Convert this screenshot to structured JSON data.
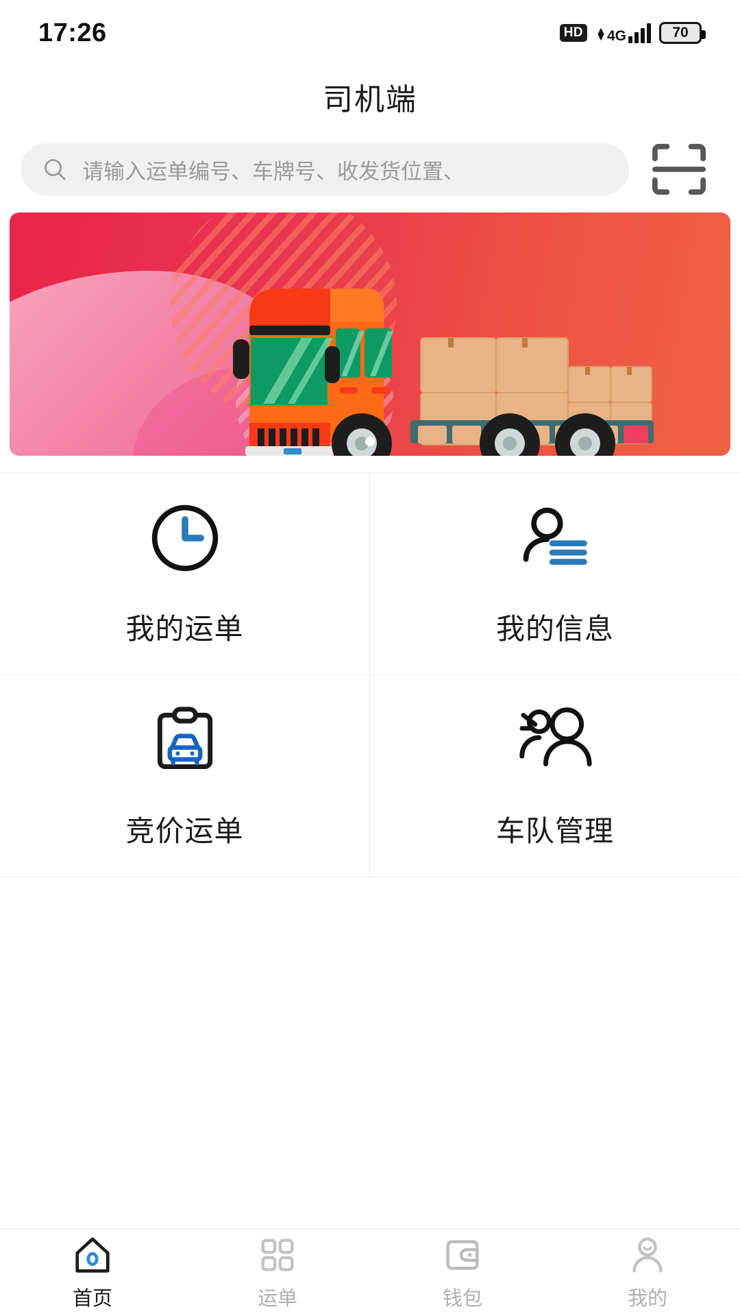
{
  "statusbar": {
    "time": "17:26",
    "hd_label": "HD",
    "network_label": "4G",
    "battery_level": "70",
    "icons": [
      "hd-icon",
      "signal-icon",
      "battery-icon"
    ]
  },
  "header": {
    "title": "司机端"
  },
  "search": {
    "placeholder": "请输入运单编号、车牌号、收发货位置、",
    "value": "",
    "search_icon": "search-icon",
    "scan_icon": "scan-qr-icon"
  },
  "banner": {
    "alt": "货运卡车插画",
    "colors": {
      "from": "#e8254a",
      "to": "#f06045",
      "blob": "#f489ab",
      "truck_body": "#ff6a17",
      "truck_cab": "#f63a16",
      "glass": "#0d9b63",
      "box": "#e3b183"
    },
    "pagination": {
      "count": 1,
      "active_index": 0
    }
  },
  "menu": {
    "items": [
      {
        "label": "我的运单",
        "icon": "clock-icon",
        "accent": "#2b7bba"
      },
      {
        "label": "我的信息",
        "icon": "user-lines-icon",
        "accent": "#2b7bba"
      },
      {
        "label": "竞价运单",
        "icon": "clipboard-car-icon",
        "accent": "#1565c0"
      },
      {
        "label": "车队管理",
        "icon": "team-group-icon",
        "accent": "#1b1b1b"
      }
    ]
  },
  "tabbar": {
    "items": [
      {
        "label": "首页",
        "icon": "home-icon",
        "active": true
      },
      {
        "label": "运单",
        "icon": "grid-icon",
        "active": false
      },
      {
        "label": "钱包",
        "icon": "wallet-icon",
        "active": false
      },
      {
        "label": "我的",
        "icon": "person-icon",
        "active": false
      }
    ]
  },
  "theme": {
    "accent_blue": "#2b7bba",
    "inactive_gray": "#b0b0b0",
    "text_dark": "#1b1b1b"
  }
}
